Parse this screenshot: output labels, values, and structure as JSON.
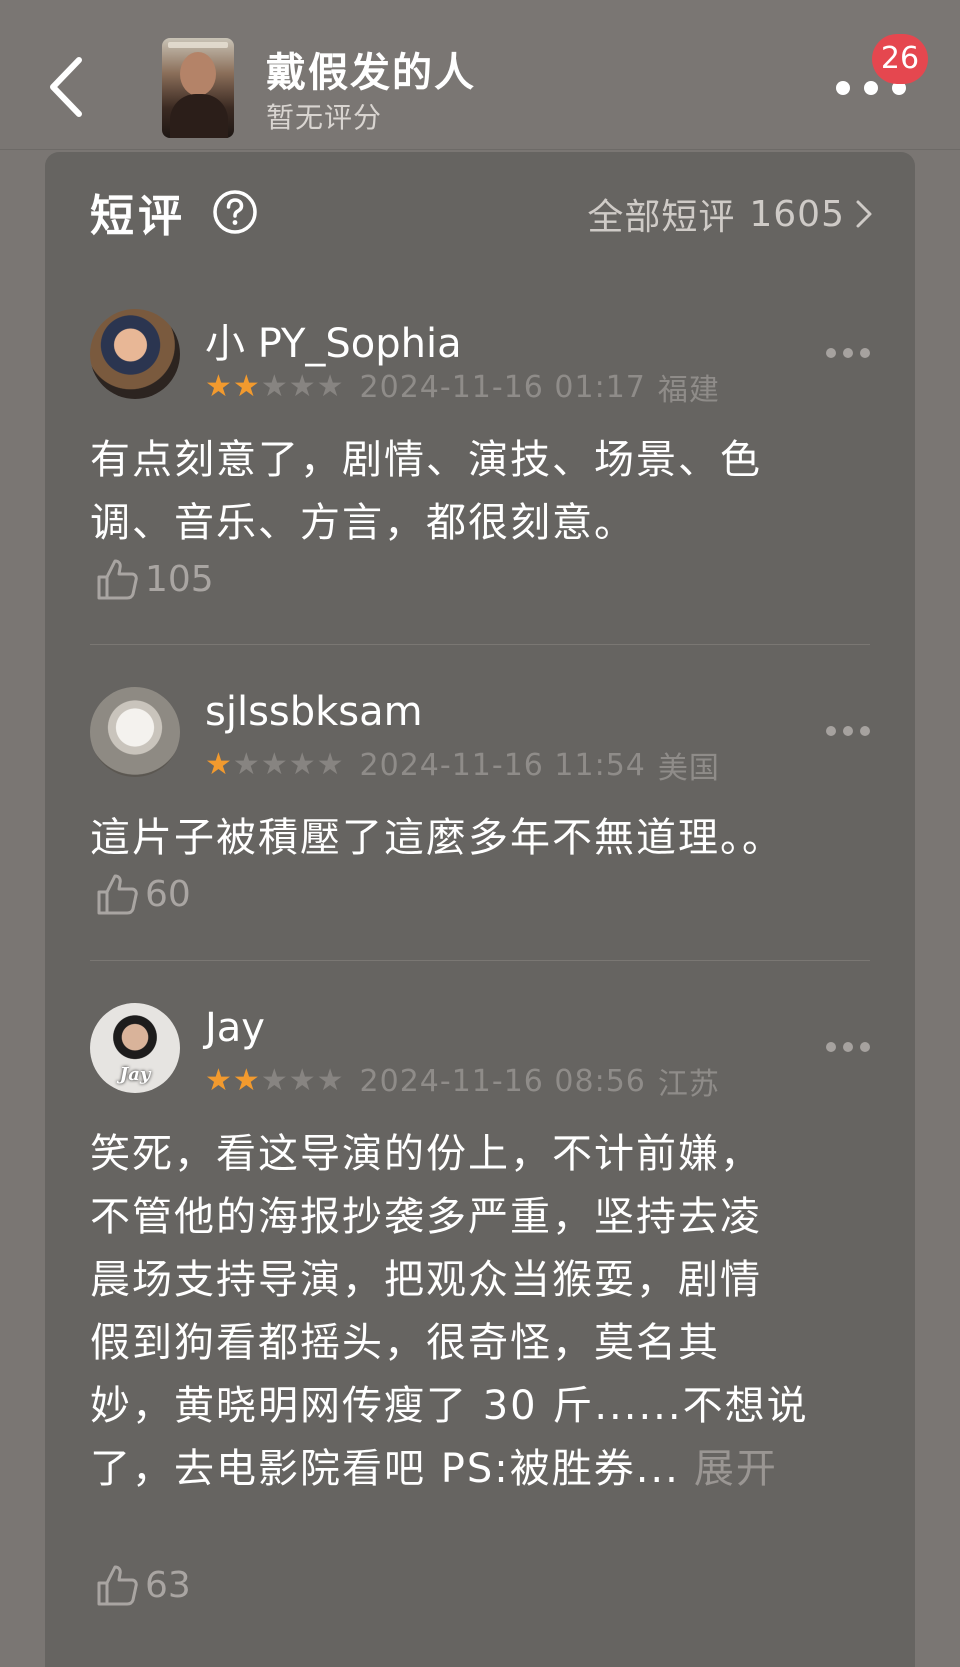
{
  "header": {
    "movie_title": "戴假发的人",
    "rating": "暂无评分",
    "badge_count": "26"
  },
  "section": {
    "title": "短评",
    "all_label": "全部短评",
    "all_count": "1605"
  },
  "colors": {
    "background": "#7a7673",
    "card": "#666461",
    "star_on": "#f29a2e",
    "star_off": "#878481",
    "badge": "#e5474f"
  },
  "reviews": [
    {
      "username": "小 PY_Sophia",
      "stars": 2,
      "datetime": "2024-11-16 01:17",
      "location": "福建",
      "lines": [
        "有点刻意了，剧情、演技、场景、色",
        "调、音乐、方言，都很刻意。"
      ],
      "likes": "105"
    },
    {
      "username": "sjlssbksam",
      "stars": 1,
      "datetime": "2024-11-16 11:54",
      "location": "美国",
      "lines": [
        "這片子被積壓了這麼多年不無道理。。"
      ],
      "likes": "60"
    },
    {
      "username": "Jay",
      "avatar_label": "Jay",
      "stars": 2,
      "datetime": "2024-11-16 08:56",
      "location": "江苏",
      "lines": [
        "笑死，看这导演的份上，不计前嫌，",
        "不管他的海报抄袭多严重，坚持去凌",
        "晨场支持导演，把观众当猴耍，剧情",
        "假到狗看都摇头，很奇怪，莫名其",
        "妙，黄晓明网传瘦了 30 斤......不想说",
        "了，去电影院看吧 PS:被胜券..."
      ],
      "expand_label": "展开",
      "likes": "63"
    }
  ]
}
